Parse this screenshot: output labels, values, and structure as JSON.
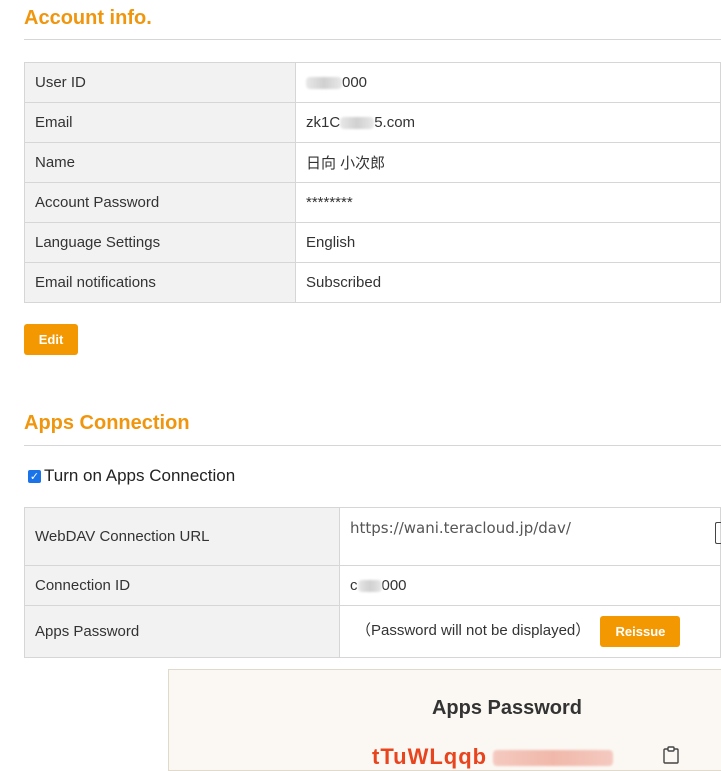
{
  "account": {
    "title": "Account info.",
    "rows": [
      {
        "label": "User ID",
        "value": "000"
      },
      {
        "label": "Email",
        "value_prefix": "zk1C",
        "value_suffix": "5.com"
      },
      {
        "label": "Name",
        "value": "日向 小次郎"
      },
      {
        "label": "Account Password",
        "value": "********"
      },
      {
        "label": "Language Settings",
        "value": "English"
      },
      {
        "label": "Email notifications",
        "value": "Subscribed"
      }
    ],
    "edit_label": "Edit"
  },
  "apps": {
    "title": "Apps Connection",
    "toggle_label": "Turn on Apps Connection",
    "toggle_checked": true,
    "rows": [
      {
        "label": "WebDAV Connection URL",
        "value": "https://wani.teracloud.jp/dav/"
      },
      {
        "label": "Connection ID",
        "value_prefix": "c",
        "value": "000"
      },
      {
        "label": "Apps Password",
        "value": "（Password will not be displayed）"
      }
    ],
    "reissue_label": "Reissue"
  },
  "modal": {
    "title": "Apps Password",
    "password_visible": "tTuWLqqb"
  },
  "colors": {
    "accent": "#f39800",
    "heading": "#f0960e",
    "password": "#e8441e"
  }
}
